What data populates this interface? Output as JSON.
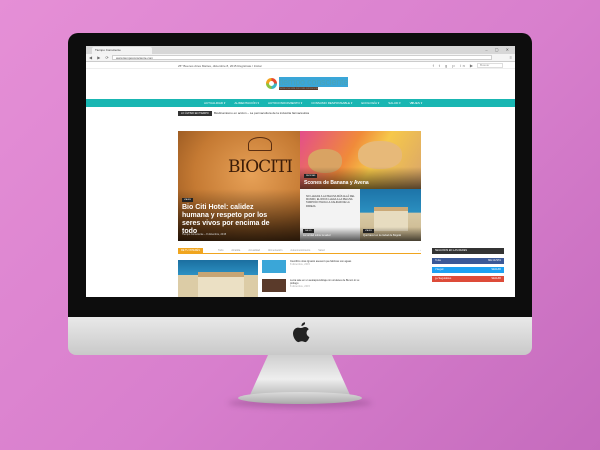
{
  "browser": {
    "tab_title": "Tiempo Consciente",
    "url": "www.tiempoconsciente.com",
    "window_controls": "– ▢ ✕",
    "nav_controls": "◀ ▶ ⟳",
    "menu_icon": "≡"
  },
  "topbar": {
    "left_text": "25°  Buenos Aires     Martes, diciembre 8, 2015     Regístrate / Iniciar",
    "social_icons": "f t g p in ▶",
    "search_placeholder": "Buscar"
  },
  "logo": {
    "name": "tiempo consciente",
    "tagline": "hacia una vida con más conciencia"
  },
  "nav": {
    "items": [
      "ACTUALIDAD ▾",
      "ALIMENTACIÓN ▾",
      "AUTOCONOCIMIENTO ▾",
      "CONSUMO RESPONSABLE ▾",
      "ECOLOGÍA ▾",
      "SALUD ▾",
      "VIAJES ▾"
    ],
    "search_icon": "⌕"
  },
  "ticker": {
    "label": "LO ÚLTIMO EN TIEMPO",
    "text": "Biodinamismo en acción – La permacultura de la industria farmacéutica"
  },
  "hero": {
    "main": {
      "badge": "VIAJES",
      "title": "Bio Citi Hotel: calidez humana y respeto por los seres vivos por encima de todo",
      "author": "Tiempo Consciente",
      "date": "8 diciembre, 2015",
      "sign_text": "BIOCITI"
    },
    "scones": {
      "badge": "RECETAS",
      "title": "Scones de Banana y Avena"
    },
    "quote": {
      "badge": "SALUD",
      "text": "No llegas a la pelusa más allá del mundo, el rock llega a la pelusa tampoco hacia la calidad de la pareja",
      "title": "La verdad sobre la salud"
    },
    "building": {
      "badge": "VIAJES",
      "title": "Qué hacer en la ciudad de Bogotá"
    }
  },
  "lower": {
    "section_label": "DE TU INTERÉS",
    "tabs": [
      "Todo",
      "Alcaldía",
      "Actualidad",
      "Alimentación",
      "Autoconocimiento",
      "Salud"
    ],
    "arrows": "‹ ›",
    "list": [
      {
        "title": "Científico José Ignacio aseveró que fabricas son aguas",
        "date": "8 diciembre, 2015"
      },
      {
        "title": "Lucía sale en un autoaprendizaje con orulanes de Bunon lo su prólogo",
        "date": "8 diciembre, 2015"
      }
    ]
  },
  "sidebar": {
    "heading": "SEGUINOS EN LAS REDES",
    "social": [
      {
        "name": "f  Like",
        "cta": "ME GUSTA",
        "color": "#3b5998"
      },
      {
        "name": "t  Seguir",
        "cta": "SEGUIR",
        "color": "#1da1f2"
      },
      {
        "name": "g+  Seguidores",
        "cta": "SEGUIR",
        "color": "#dd4b39"
      }
    ]
  }
}
